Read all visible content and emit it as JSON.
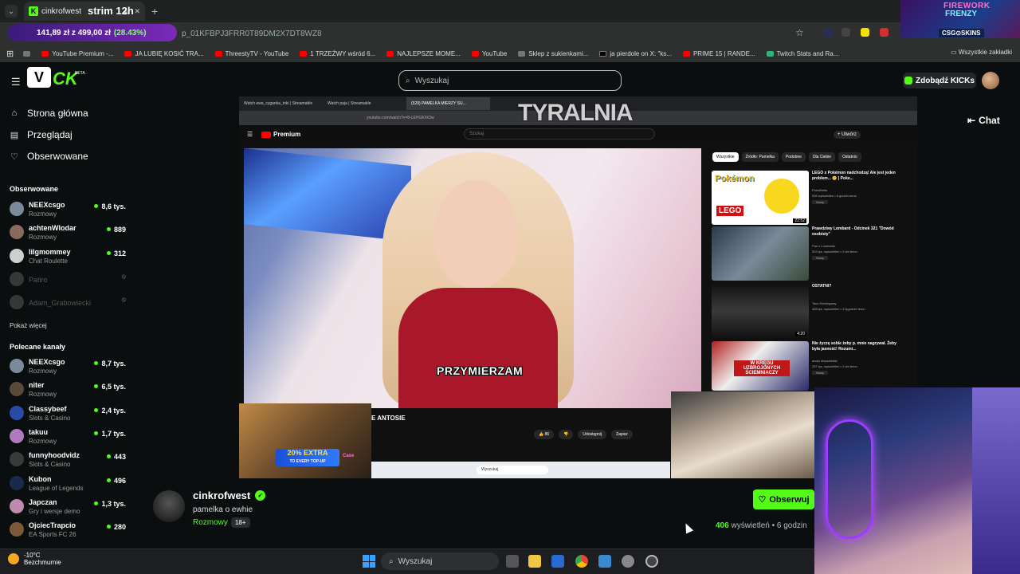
{
  "browser": {
    "tab_title": "cinkrofwest",
    "tab_overlay": "strim 12h",
    "url_fragment": "p_01KFBPJ3FRR0T89DM2X7DT8WZ8",
    "price_widget": {
      "text": "141,89 zł z 499,00 zł",
      "percent": "(28.43%)"
    },
    "bookmarks": [
      "YouTube Premium -...",
      "JA LUBIĘ KOSIĆ TRA...",
      "ThreestyTV - YouTube",
      "1 TRZEŹWY wśród 6...",
      "NAJLEPSZE MOME...",
      "YouTube",
      "Sklep z sukienkami...",
      "jа pierdole on X: \"ks...",
      "PRIME 15 | RANDE...",
      "Twitch Stats and Ra..."
    ],
    "all_bookmarks": "Wszystkie zakładki"
  },
  "csgo_banner": {
    "line1": "FIREWORK",
    "line2": "FRENZY",
    "brand": "CSG⊙SKINS"
  },
  "kick": {
    "beta": "BETA",
    "search_placeholder": "Wyszukaj",
    "kicks_button": "Zdobądź KICKs",
    "nav": [
      {
        "label": "Strona główna",
        "icon": "home-icon"
      },
      {
        "label": "Przeglądaj",
        "icon": "browse-icon"
      },
      {
        "label": "Obserwowane",
        "icon": "heart-icon"
      }
    ],
    "followed_heading": "Obserwowane",
    "followed": [
      {
        "name": "NEEXcsgo",
        "category": "Rozmowy",
        "viewers": "8,6 tys.",
        "color": "#7a8a9a"
      },
      {
        "name": "achtenWlodar",
        "category": "Rozmowy",
        "viewers": "889",
        "color": "#8a6a5a"
      },
      {
        "name": "lilgmommey",
        "category": "Chat Roulette",
        "viewers": "312",
        "color": "#cfcfcf"
      },
      {
        "name": "Patiro",
        "category": "",
        "viewers": "",
        "color": "#888888"
      },
      {
        "name": "Adam_Grabowiecki",
        "category": "",
        "viewers": "",
        "color": "#888888"
      }
    ],
    "show_more": "Pokaż więcej",
    "recommended_heading": "Polecane kanały",
    "recommended": [
      {
        "name": "NEEXcsgo",
        "category": "Rozmowy",
        "viewers": "8,7 tys.",
        "color": "#7a8a9a"
      },
      {
        "name": "niter",
        "category": "Rozmowy",
        "viewers": "6,5 tys.",
        "color": "#5a4a3a"
      },
      {
        "name": "Classybeef",
        "category": "Slots & Casino",
        "viewers": "2,4 tys.",
        "color": "#2a4aa8"
      },
      {
        "name": "takuu",
        "category": "Rozmowy",
        "viewers": "1,7 tys.",
        "color": "#b07ac0"
      },
      {
        "name": "funnyhoodvidz",
        "category": "Slots & Casino",
        "viewers": "443",
        "color": "#3a3a3a"
      },
      {
        "name": "Kubon",
        "category": "League of Legends",
        "viewers": "496",
        "color": "#1a2a4a"
      },
      {
        "name": "Japczan",
        "category": "Gry i wersje demo",
        "viewers": "1,3 tys.",
        "color": "#c08ab0"
      },
      {
        "name": "OjciecTrapcio",
        "category": "EA Sports FC 26",
        "viewers": "280",
        "color": "#7a5a3a"
      }
    ],
    "chat_button": "Chat",
    "stream": {
      "streamer": "cinkrofwest",
      "title": "pamelka o ewhie",
      "category": "Rozmowy",
      "age": "18+",
      "follow": "Obserwuj",
      "views_count": "406",
      "views_label": "wyświetleń",
      "time_ago": "• 6 godzin"
    }
  },
  "inner_browser": {
    "tabs": [
      "Watch ewa_cyganka_tnki | Streamable",
      "Watch paja | Streamable",
      "(529) PAMELKA MIERZY SU..."
    ],
    "url": "youtube.com/watch?v=8-LEHGKXiOw",
    "overlay_text": "TYRALNIA",
    "yt_brand": "Premium",
    "yt_search": "Szukaj",
    "create_button": "+ Utwórz",
    "chips": [
      "Wszystkie",
      "Źródło: Pamelka",
      "Podobne",
      "Dla Ciebie",
      "Ostatnio"
    ],
    "subtitle": "PRZYMIERZAM",
    "video_title": "E ANTOSIE",
    "actions": [
      "👍 86",
      "👎",
      "Udostępnij",
      "Zapisz"
    ],
    "inner_taskbar_search": "Wyszukaj",
    "sidebar_videos": [
      {
        "title": "LEGO x Pokémon nadchodzą! Ale jest jeden problem... 🙃 | Poke...",
        "channel": "PokoMafia",
        "meta": "636 wyświetleń • 6 godzin temu",
        "badge": "Nowy",
        "thumb": "pokemon"
      },
      {
        "title": "Prawdziwy Lombard - Odcinek 321 \"Dowód osobisty\"",
        "channel": "Pan z Lombardu",
        "meta": "303 tys. wyświetleń • 2 dni temu",
        "badge": "Nowy",
        "thumb": "crowd"
      },
      {
        "title": "OSTATNI?",
        "channel": "Taco Hemingway",
        "meta": "468 tys. wyświetleń • 4 tygodnie temu",
        "badge": "",
        "thumb": "dark"
      },
      {
        "title": "Nie życzę sobie żeby p. mnie nagrywał. Żeby była jasność! Rozumi...",
        "channel": "audyt obywatelski",
        "meta": "257 tys. wyświetleń • 2 dni temu",
        "badge": "Nowy",
        "thumb": "police"
      }
    ],
    "thumb_labels": {
      "pokemon": "Pokémon",
      "lego": "LEGO",
      "time1": "22:52",
      "time3": "4:20",
      "police": "W KRĘGU UZBROJONYCH ŚCIEMNIACZY"
    }
  },
  "promo": {
    "big": "20% EXTRA",
    "small": "TO EVERY TOP-UP",
    "brand": "Case"
  },
  "taskbar": {
    "temp": "-10°C",
    "weather": "Bezchmurnie",
    "search": "Wyszukaj"
  }
}
